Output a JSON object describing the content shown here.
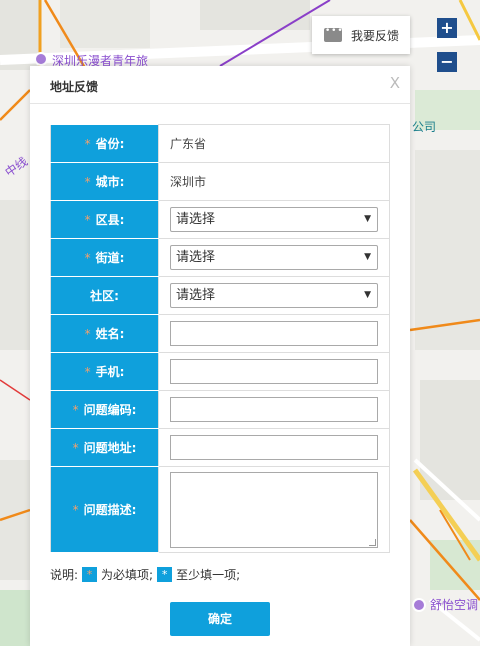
{
  "map": {
    "labels": {
      "hostel": "深圳乐漫者青年旅",
      "company": "公司",
      "line_fragment": "中线",
      "shop": "舒怡空调"
    },
    "zoom_in": "+",
    "zoom_out": "−"
  },
  "feedback_button": {
    "label": "我要反馈",
    "icon": "chat-icon"
  },
  "dialog": {
    "title": "地址反馈",
    "close": "X",
    "rows": [
      {
        "label": "省份:",
        "required": true,
        "type": "text",
        "value": "广东省"
      },
      {
        "label": "城市:",
        "required": true,
        "type": "text",
        "value": "深圳市"
      },
      {
        "label": "区县:",
        "required": true,
        "type": "select",
        "value": "请选择"
      },
      {
        "label": "街道:",
        "required": true,
        "type": "select",
        "value": "请选择"
      },
      {
        "label": "社区:",
        "required": false,
        "type": "select",
        "value": "请选择"
      },
      {
        "label": "姓名:",
        "required": true,
        "type": "input",
        "value": ""
      },
      {
        "label": "手机:",
        "required": true,
        "type": "input",
        "value": ""
      },
      {
        "label": "问题编码:",
        "required": true,
        "type": "input",
        "value": ""
      },
      {
        "label": "问题地址:",
        "required": true,
        "type": "input",
        "value": ""
      },
      {
        "label": "问题描述:",
        "required": true,
        "type": "textarea",
        "value": ""
      }
    ],
    "note": {
      "prefix": "说明:",
      "required_text": "为必填项;",
      "atleast_text": "至少填一项;",
      "star": "*"
    },
    "submit_label": "确定"
  },
  "colors": {
    "accent": "#0fa0dc",
    "required_star": "#f6a16c",
    "zoom": "#1f4e8c"
  }
}
